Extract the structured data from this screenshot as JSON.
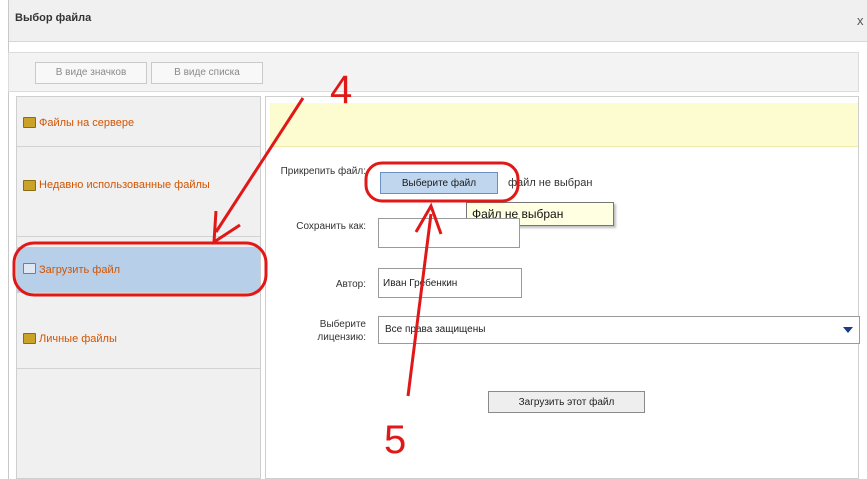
{
  "window": {
    "title": "Выбор файла",
    "close_glyph": "x"
  },
  "toolbar": {
    "icons_view_label": "В виде значков",
    "list_view_label": "В виде списка"
  },
  "sidebar": {
    "items": [
      {
        "label": "Файлы на сервере",
        "icon": "folder-icon"
      },
      {
        "label": "Недавно использованные файлы",
        "icon": "folder-icon"
      },
      {
        "label": "Загрузить файл",
        "icon": "upload-icon",
        "active": true
      },
      {
        "label": "Личные файлы",
        "icon": "folder-icon"
      }
    ]
  },
  "form": {
    "attach_label": "Прикрепить файл:",
    "choose_button_label": "Выберите файл",
    "no_file_text": "файл не выбран",
    "tooltip_text": "Файл не выбран",
    "save_as_label": "Сохранить как:",
    "save_as_value": "",
    "author_label": "Автор:",
    "author_value": "Иван Гребенкин",
    "license_label": "Выберите лицензию:",
    "license_value": "Все права защищены",
    "upload_button_label": "Загрузить этот файл"
  },
  "annotations": {
    "step4": "4",
    "step5": "5",
    "color": "#e01818"
  }
}
